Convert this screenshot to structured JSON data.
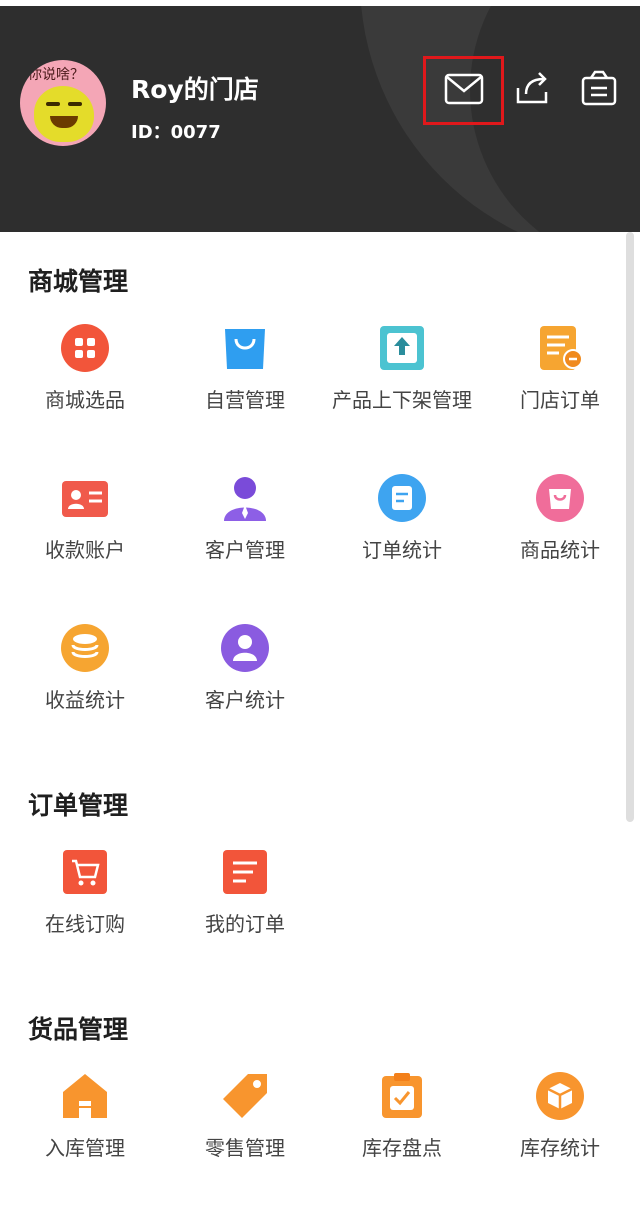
{
  "header": {
    "store_name": "Roy的门店",
    "store_id": "ID：0077",
    "avatar_caption": "你说啥？",
    "icons": [
      "mail-icon",
      "share-icon",
      "store-icon"
    ]
  },
  "sections": [
    {
      "title": "商城管理",
      "items": [
        {
          "label": "商城选品",
          "icon": "grid-icon",
          "color": "#f2553a"
        },
        {
          "label": "自营管理",
          "icon": "shopping-bag-icon",
          "color": "#2f9ef0"
        },
        {
          "label": "产品上下架管理",
          "icon": "upload-box-icon",
          "color": "#4cc3d1"
        },
        {
          "label": "门店订单",
          "icon": "order-doc-icon",
          "color": "#f6a531"
        },
        {
          "label": "收款账户",
          "icon": "account-card-icon",
          "color": "#f05a4b"
        },
        {
          "label": "客户管理",
          "icon": "customer-icon",
          "color": "#7a4bd9"
        },
        {
          "label": "订单统计",
          "icon": "order-stat-icon",
          "color": "#3ea4f0"
        },
        {
          "label": "商品统计",
          "icon": "product-stat-icon",
          "color": "#f06d9a"
        },
        {
          "label": "收益统计",
          "icon": "coins-icon",
          "color": "#f6a531"
        },
        {
          "label": "客户统计",
          "icon": "customer-stat-icon",
          "color": "#8a5be0"
        }
      ]
    },
    {
      "title": "订单管理",
      "items": [
        {
          "label": "在线订购",
          "icon": "cart-icon",
          "color": "#f2553a"
        },
        {
          "label": "我的订单",
          "icon": "my-order-icon",
          "color": "#f2553a"
        }
      ]
    },
    {
      "title": "货品管理",
      "items": [
        {
          "label": "入库管理",
          "icon": "warehouse-icon",
          "color": "#f8952e"
        },
        {
          "label": "零售管理",
          "icon": "tag-icon",
          "color": "#f8952e"
        },
        {
          "label": "库存盘点",
          "icon": "clipboard-check-icon",
          "color": "#f8952e"
        },
        {
          "label": "库存统计",
          "icon": "box-icon",
          "color": "#f8952e"
        }
      ]
    }
  ]
}
